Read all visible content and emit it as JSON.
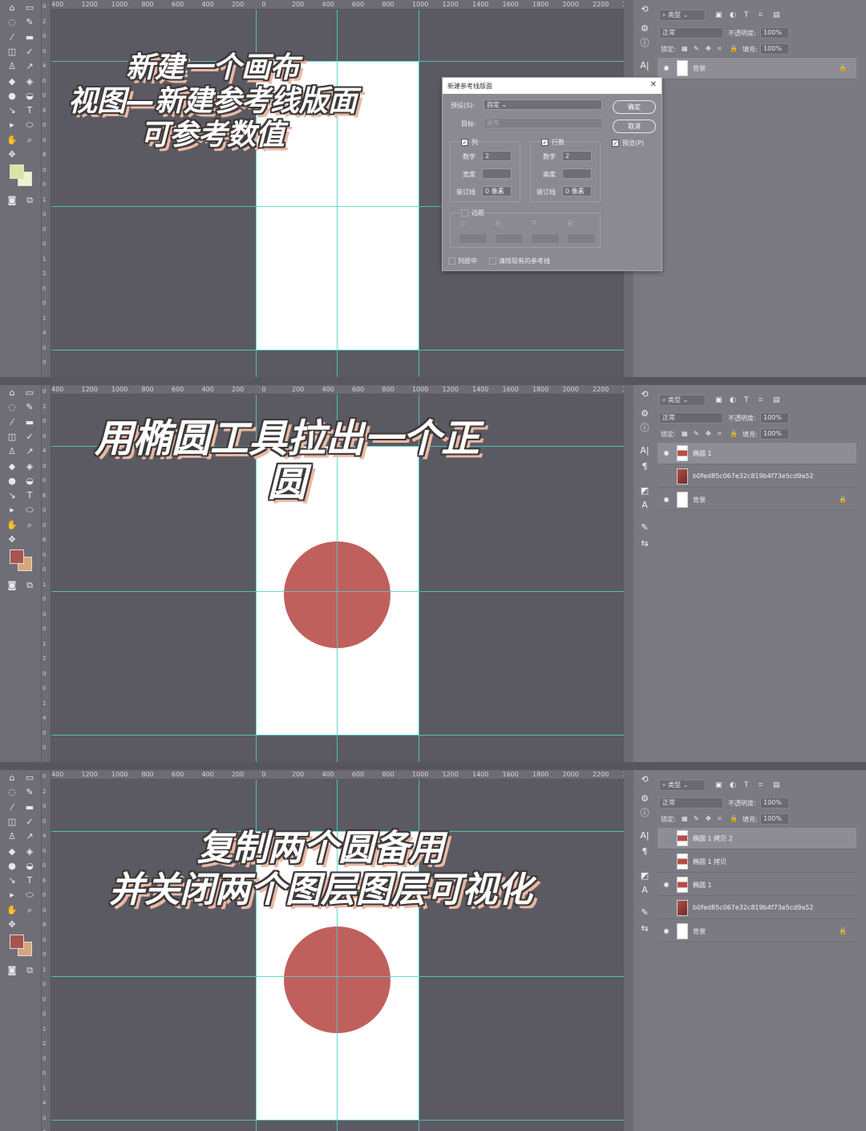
{
  "hruler_ticks": [
    "400",
    "1200",
    "1000",
    "800",
    "600",
    "400",
    "200",
    "0",
    "200",
    "400",
    "600",
    "800",
    "1000",
    "1200",
    "1400",
    "1600",
    "1800",
    "2000",
    "2200",
    "24"
  ],
  "vruler_digits": [
    "0",
    "2",
    "0",
    "0",
    "4",
    "0",
    "0",
    "6",
    "0",
    "0",
    "8",
    "0",
    "0",
    "1",
    "0",
    "0",
    "0",
    "1",
    "2",
    "0",
    "0",
    "1",
    "4",
    "0",
    "0"
  ],
  "colors": {
    "accent_circle": "#c0605c",
    "guide": "#4fd0c8",
    "caption_shadow": "#e9b8a4",
    "swatch_light_fg": "#d6e7a3",
    "swatch_light_bg": "#eef3cf",
    "swatch_red_fg": "#a8544f",
    "swatch_red_bg": "#d6a679"
  },
  "layer_panel": {
    "filter_label": "类型",
    "blend_mode": "正常",
    "opacity_label": "不透明度:",
    "opacity_value": "100%",
    "lock_label": "锁定:",
    "fill_label": "填充:",
    "fill_value": "100%"
  },
  "panels": [
    {
      "caption_lines": [
        "新建一个画布",
        "视图—新建参考线版面",
        "可参考数值"
      ],
      "layers": [
        {
          "name": "背景",
          "visible": true,
          "locked": true,
          "selected": true,
          "thumb": "white"
        }
      ]
    },
    {
      "caption_lines": [
        "用椭圆工具拉出一个正",
        "圆"
      ],
      "layers": [
        {
          "name": "椭圆 1",
          "visible": true,
          "locked": false,
          "selected": true,
          "thumb": "red"
        },
        {
          "name": "b0fed85c067e32c819b4f73e5cd9a52",
          "visible": false,
          "locked": false,
          "selected": false,
          "thumb": "photo"
        },
        {
          "name": "背景",
          "visible": true,
          "locked": true,
          "selected": false,
          "thumb": "white"
        }
      ]
    },
    {
      "caption_lines": [
        "复制两个圆备用",
        "并关闭两个图层图层可视化"
      ],
      "layers": [
        {
          "name": "椭圆 1 拷贝 2",
          "visible": false,
          "locked": false,
          "selected": true,
          "thumb": "red"
        },
        {
          "name": "椭圆 1 拷贝",
          "visible": false,
          "locked": false,
          "selected": false,
          "thumb": "red"
        },
        {
          "name": "椭圆 1",
          "visible": true,
          "locked": false,
          "selected": false,
          "thumb": "red"
        },
        {
          "name": "b0fed85c067e32c819b4f73e5cd9a52",
          "visible": false,
          "locked": false,
          "selected": false,
          "thumb": "photo"
        },
        {
          "name": "背景",
          "visible": true,
          "locked": true,
          "selected": false,
          "thumb": "white"
        }
      ]
    }
  ],
  "dialog": {
    "title": "新建参考线版面",
    "preset_label": "预设(S):",
    "preset_value": "自定",
    "target_label": "目标:",
    "target_value": "画布",
    "ok_label": "确定",
    "cancel_label": "取消",
    "preview_label": "预览(P)",
    "columns_label": "列",
    "rows_label": "行数",
    "number_label": "数字",
    "columns_number": "2",
    "rows_number": "2",
    "width_label": "宽度",
    "height_label": "高度",
    "gutter_label": "装订线",
    "columns_gutter": "0 像素",
    "rows_gutter": "0 像素",
    "margin_label": "边距",
    "margin_top": "上:",
    "margin_left": "左:",
    "margin_bottom": "下:",
    "margin_right": "右:",
    "center_columns_label": "列居中",
    "clear_guides_label": "清除现有的参考线"
  }
}
